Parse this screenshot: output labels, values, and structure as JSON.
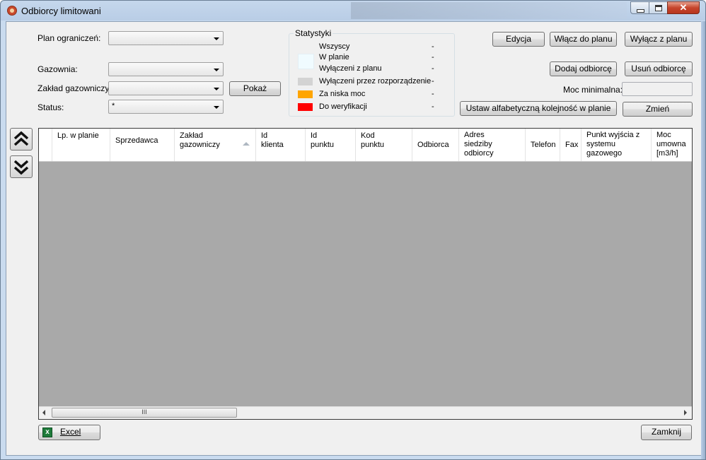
{
  "window": {
    "title": "Odbiorcy limitowani",
    "close_glyph": "✕"
  },
  "filters": {
    "plan_label": "Plan ograniczeń:",
    "plan_value": "",
    "gazownia_label": "Gazownia:",
    "gazownia_value": "",
    "zaklad_label": "Zakład gazowniczy:",
    "zaklad_value": "",
    "status_label": "Status:",
    "status_value": "*",
    "show_button": "Pokaż"
  },
  "stats": {
    "title": "Statystyki",
    "rows": [
      {
        "label": "Wszyscy",
        "value": "-",
        "color": ""
      },
      {
        "label": "W planie",
        "value": "-",
        "color": "#f0fbff"
      },
      {
        "label": "Wyłączeni z planu",
        "value": "-",
        "color": ""
      },
      {
        "label": "Wyłączeni przez rozporządzenie",
        "value": "-",
        "color": "#d3d3d3"
      },
      {
        "label": "Za niska moc",
        "value": "-",
        "color": "#ffa500"
      },
      {
        "label": "Do weryfikacji",
        "value": "-",
        "color": "#ff0000"
      }
    ]
  },
  "actions": {
    "edit": "Edycja",
    "add_to_plan": "Włącz do planu",
    "remove_from_plan": "Wyłącz z planu",
    "add_recipient": "Dodaj odbiorcę",
    "delete_recipient": "Usuń odbiorcę",
    "min_power_label": "Moc minimalna:",
    "min_power_value": "",
    "alphabetical_order": "Ustaw alfabetyczną kolejność w planie",
    "change": "Zmień"
  },
  "nav": {
    "up_icon": "double-chevron-up-icon",
    "down_icon": "double-chevron-down-icon"
  },
  "grid": {
    "columns": [
      {
        "label": "Lp. w planie"
      },
      {
        "label": "Sprzedawca"
      },
      {
        "label": "Zakład gazowniczy",
        "sorted": "asc"
      },
      {
        "label": "Id klienta"
      },
      {
        "label": "Id punktu"
      },
      {
        "label": "Kod punktu"
      },
      {
        "label": "Odbiorca"
      },
      {
        "label": "Adres siedziby odbiorcy"
      },
      {
        "label": "Telefon"
      },
      {
        "label": "Fax"
      },
      {
        "label": "Punkt wyjścia z systemu gazowego"
      },
      {
        "label": "Moc umowna [m3/h]"
      }
    ],
    "scroll_grip": "III"
  },
  "footer": {
    "excel": "Excel",
    "close": "Zamknij"
  }
}
